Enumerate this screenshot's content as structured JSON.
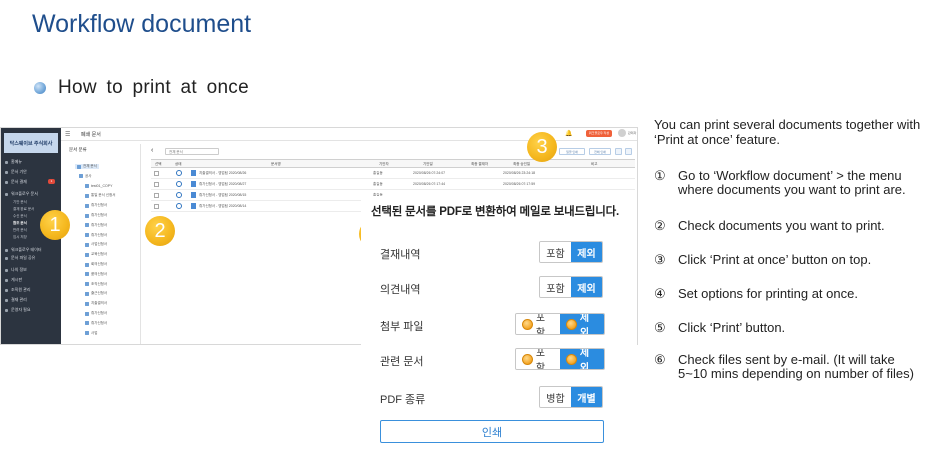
{
  "slide": {
    "title": "Workflow document",
    "bullet": "How to print at once"
  },
  "app": {
    "logo_text": "닥스웨이브 주식회사",
    "page_name": "폐쇄 문서",
    "sidebar": [
      {
        "label": "홈메뉴"
      },
      {
        "label": "문서 기안"
      },
      {
        "label": "문서 결재",
        "badge": "1"
      },
      {
        "label": "워크플로우 문서"
      },
      {
        "label": "워크플로우 테이터"
      },
      {
        "label": "문서 파일 공유"
      },
      {
        "label": "나의 정보"
      },
      {
        "label": "게시판"
      },
      {
        "label": "조직원 관리"
      },
      {
        "label": "결재 관리"
      },
      {
        "label": "운영자 필요"
      }
    ],
    "sidebar_sub": [
      "기안 문서",
      "결재 완료 문서",
      "수신 문서",
      "참조 문서",
      "반려 문서",
      "임시 저장"
    ],
    "top_button": "워크플로우 작성",
    "user": "관리자",
    "tree_title": "문서 분류",
    "tree_items": [
      "전체 문서",
      "공사",
      "test01_COPY",
      "통일 문서 신청서",
      "휴가신청서",
      "휴가신청서",
      "휴가신청서",
      "휴가신청서",
      "사업신청서",
      "교육신청서",
      "회의신청서",
      "품의신청서",
      "조직신청서",
      "출근신청서",
      "지출결의서",
      "휴가신청서",
      "휴가신청서",
      "사업"
    ],
    "folder_select": "전체 문서",
    "toolbar": [
      "일괄 인쇄",
      "전체 인쇄"
    ],
    "columns": [
      "선택",
      "상태",
      "문서명",
      "기안자",
      "기안일",
      "최종 결재자",
      "최종 승인일",
      "비고"
    ],
    "rows": [
      {
        "name": "지출결의서 - 영업팀 2020/08/26",
        "drafter": "홍길동",
        "date": "2020/08/26 07:24:07",
        "final_date": "2020/08/26 23:24:18"
      },
      {
        "name": "휴가신청서 - 영업팀 2020/08/27",
        "drafter": "홍길동",
        "date": "2020/08/26 07:17:44",
        "final_date": "2020/08/26 07:17:59"
      },
      {
        "name": "휴가신청서 - 영업팀 2020/08/15",
        "drafter": "홍길동",
        "date": "",
        "final_date": ""
      },
      {
        "name": "휴가신청서 - 영업팀 2020/08/14",
        "drafter": "홍길동",
        "date": "",
        "final_date": ""
      }
    ]
  },
  "markers": [
    "1",
    "2",
    "3",
    "4"
  ],
  "dialog": {
    "title": "선택된 문서를 PDF로 변환하여 메일로 보내드립니다.",
    "options": [
      {
        "label": "결재내역",
        "a": "포함",
        "b": "제외",
        "coins": false
      },
      {
        "label": "의견내역",
        "a": "포함",
        "b": "제외",
        "coins": false
      },
      {
        "label": "첨부 파일",
        "a": "포함",
        "b": "제외",
        "coins": true
      },
      {
        "label": "관련 문서",
        "a": "포함",
        "b": "제외",
        "coins": true
      },
      {
        "label": "PDF 종류",
        "a": "병합",
        "b": "개별",
        "coins": false
      }
    ],
    "print_label": "인쇄"
  },
  "instructions": {
    "intro": "You can print several documents together with ‘Print at once’ feature.",
    "steps": [
      {
        "num": "①",
        "text": "Go to ‘Workflow document’ > the menu where documents you want to print are."
      },
      {
        "num": "②",
        "text": "Check documents you want to print."
      },
      {
        "num": "③",
        "text": "Click ‘Print at once’ button on top."
      },
      {
        "num": "④",
        "text": "Set options for printing at once."
      },
      {
        "num": "⑤",
        "text": "Click ‘Print’ button."
      },
      {
        "num": "⑥",
        "text": "Check files sent by e-mail. (It will take 5~10 mins depending on number of files)"
      }
    ]
  },
  "colors": {
    "title_blue": "#1f4e8c",
    "accent_blue": "#2b8ce0",
    "marker_yellow": "#f5b81f",
    "sidebar_dark": "#2c3440"
  }
}
